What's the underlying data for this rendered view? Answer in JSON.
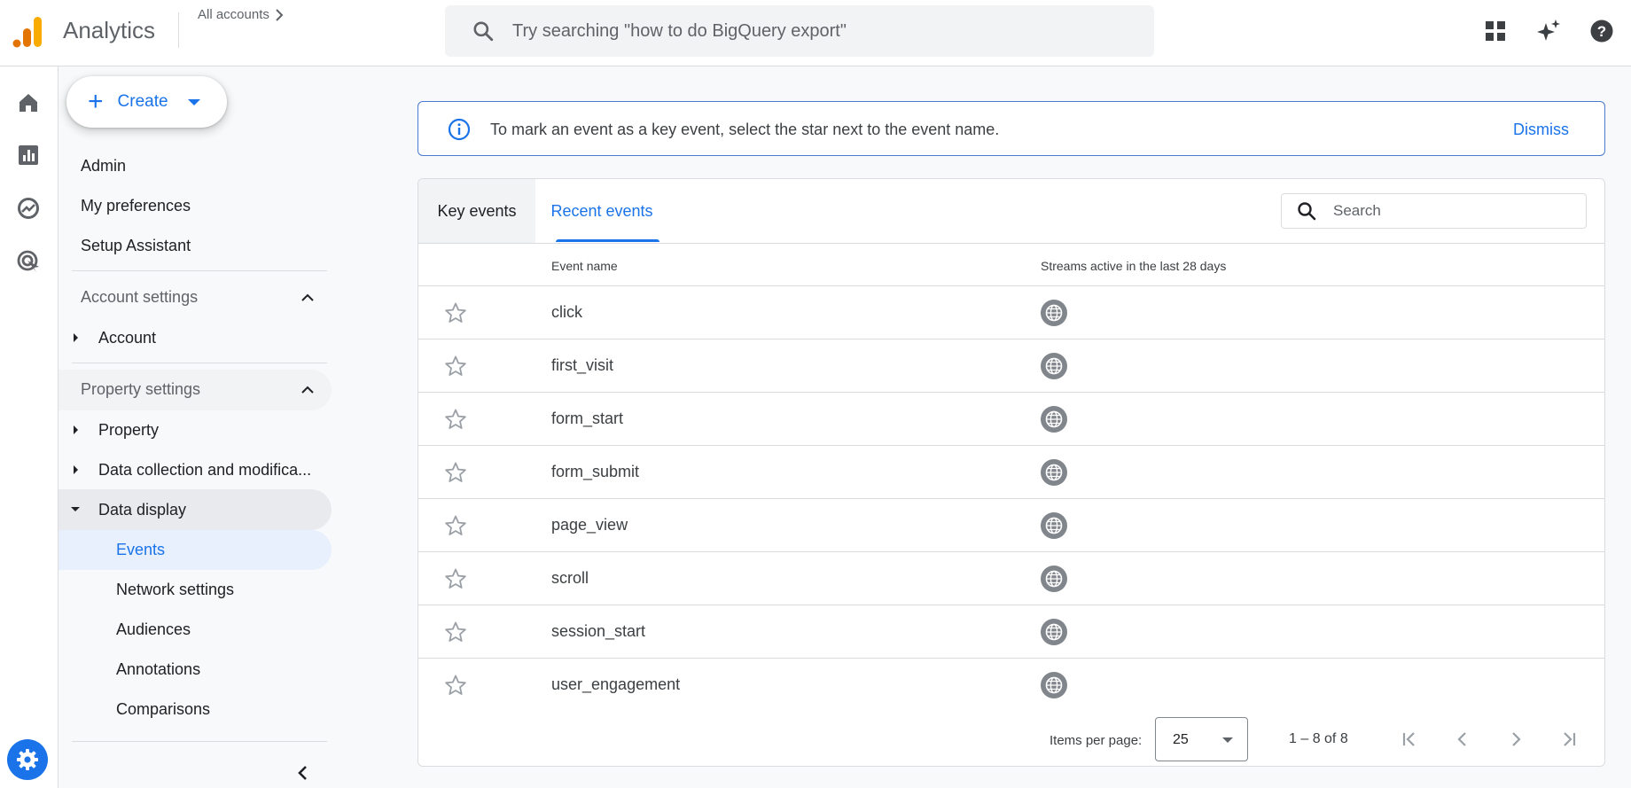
{
  "app": {
    "title": "Analytics",
    "breadcrumb": "All accounts"
  },
  "search": {
    "placeholder": "Try searching \"how to do BigQuery export\""
  },
  "sidebar": {
    "create_label": "Create",
    "items": [
      "Admin",
      "My preferences",
      "Setup Assistant"
    ],
    "account_section": "Account settings",
    "account_item": "Account",
    "property_section": "Property settings",
    "property_items": [
      "Property",
      "Data collection and modifica...",
      "Data display"
    ],
    "display_items": [
      "Events",
      "Network settings",
      "Audiences",
      "Annotations",
      "Comparisons"
    ]
  },
  "banner": {
    "message": "To mark an event as a key event, select the star next to the event name.",
    "dismiss": "Dismiss"
  },
  "events_card": {
    "tabs": [
      "Key events",
      "Recent events"
    ],
    "active_tab": "Recent events",
    "search_placeholder": "Search",
    "columns": [
      "Event name",
      "Streams active in the last 28 days"
    ],
    "rows": [
      "click",
      "first_visit",
      "form_start",
      "form_submit",
      "page_view",
      "scroll",
      "session_start",
      "user_engagement"
    ]
  },
  "pagination": {
    "items_per_page_label": "Items per page:",
    "items_per_page": "25",
    "range": "1 – 8 of 8"
  },
  "colors": {
    "accent": "#1a73e8",
    "logo_orange": "#f9ab00",
    "logo_dark_orange": "#e37400"
  },
  "icons": {
    "top": [
      "apps-grid-icon",
      "sparkle-icon",
      "help-icon"
    ],
    "rail": [
      "home-icon",
      "reports-icon",
      "explore-icon",
      "advertising-icon",
      "settings-icon"
    ],
    "row": [
      "star-icon",
      "globe-icon"
    ]
  }
}
